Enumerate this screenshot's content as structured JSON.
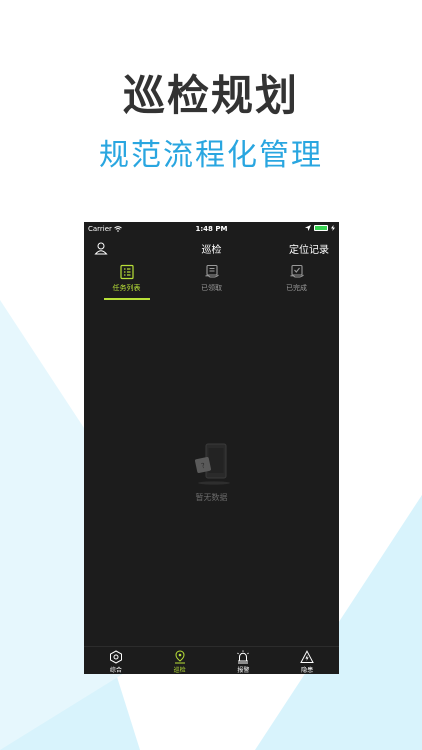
{
  "marketing": {
    "headline": "巡检规划",
    "subline": "规范流程化管理"
  },
  "colors": {
    "accent": "#b8e038",
    "subline": "#29a6e0",
    "background_shape": "#d8f3fc"
  },
  "statusbar": {
    "carrier": "Carrier",
    "time": "1:48 PM",
    "battery_level": 1.0
  },
  "navbar": {
    "title": "巡检",
    "right_label": "定位记录",
    "left_icon": "user-icon"
  },
  "tabs": [
    {
      "label": "任务列表",
      "icon": "task-list-icon",
      "active": true
    },
    {
      "label": "已领取",
      "icon": "received-icon",
      "active": false
    },
    {
      "label": "已完成",
      "icon": "completed-icon",
      "active": false
    }
  ],
  "empty_state": {
    "text": "暂无数据",
    "icon": "empty-phone-icon"
  },
  "bottom_nav": [
    {
      "label": "综合",
      "icon": "hexagon-icon",
      "active": false
    },
    {
      "label": "巡检",
      "icon": "location-pin-icon",
      "active": true
    },
    {
      "label": "报警",
      "icon": "alarm-icon",
      "active": false
    },
    {
      "label": "隐患",
      "icon": "hazard-icon",
      "active": false
    }
  ]
}
